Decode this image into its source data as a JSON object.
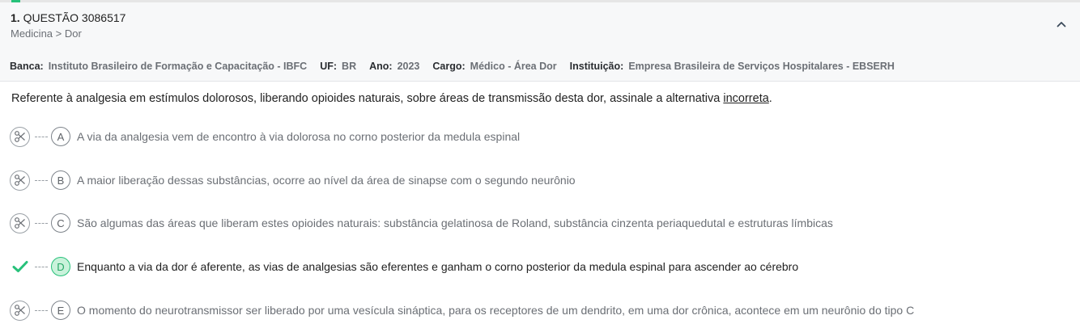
{
  "question": {
    "number": "1.",
    "label": "QUESTÃO 3086517",
    "breadcrumb": "Medicina > Dor"
  },
  "meta": {
    "banca_label": "Banca:",
    "banca_value": "Instituto Brasileiro de Formação e Capacitação - IBFC",
    "uf_label": "UF:",
    "uf_value": "BR",
    "ano_label": "Ano:",
    "ano_value": "2023",
    "cargo_label": "Cargo:",
    "cargo_value": "Médico - Área Dor",
    "instituicao_label": "Instituição:",
    "instituicao_value": "Empresa Brasileira de Serviços Hospitalares - EBSERH"
  },
  "statement": {
    "text_before": "Referente à analgesia em estímulos dolorosos, liberando opioides naturais, sobre áreas de transmissão desta dor, assinale a alternativa ",
    "underlined": "incorreta",
    "text_after": "."
  },
  "alternatives": [
    {
      "letter": "A",
      "text": "A via da analgesia vem de encontro à via dolorosa no corno posterior da medula espinal",
      "icon": "scissors-icon",
      "correct": false
    },
    {
      "letter": "B",
      "text": "A maior liberação dessas substâncias, ocorre ao nível da área de sinapse com o segundo neurônio",
      "icon": "scissors-icon",
      "correct": false
    },
    {
      "letter": "C",
      "text": "São algumas das áreas que liberam estes opioides naturais: substância gelatinosa de Roland, substância cinzenta periaquedutal e estruturas límbicas",
      "icon": "scissors-icon",
      "correct": false
    },
    {
      "letter": "D",
      "text": "Enquanto a via da dor é aferente, as vias de analgesias são eferentes e ganham o corno posterior da medula espinal para ascender ao cérebro",
      "icon": "check-icon",
      "correct": true
    },
    {
      "letter": "E",
      "text": "O momento do neurotransmissor ser liberado por uma vesícula sináptica, para os receptores de um dendrito, em uma dor crônica, acontece em um neurônio do tipo C",
      "icon": "scissors-icon",
      "correct": false
    }
  ],
  "colors": {
    "accent_green": "#27c17a",
    "correct_fill": "#c9f2db",
    "muted_text": "#6b6f75"
  },
  "icons": {
    "collapse": "chevron-up-icon"
  }
}
